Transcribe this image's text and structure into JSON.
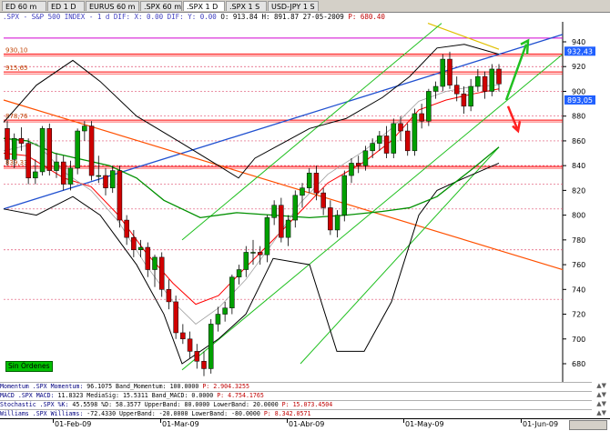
{
  "tabs": [
    {
      "label": "ED 60 m",
      "active": false
    },
    {
      "label": "ED 1 D",
      "active": false
    },
    {
      "label": "EURUS 60 m",
      "active": false
    },
    {
      "label": ".SPX 60 m",
      "active": false
    },
    {
      "label": ".SPX 1 D",
      "active": true
    },
    {
      "label": ".SPX 1 S",
      "active": false
    },
    {
      "label": "USD-JPY 1 S",
      "active": false
    }
  ],
  "header": {
    "symbol": ".SPX - S&P 500 INDEX - 1 d DIF: X: 0.00 DIF: Y: 0.00",
    "values": "O: 913.84 H: 891.87 27-05-2009",
    "p": "P: 680.40"
  },
  "levels": [
    {
      "label": "930,10",
      "value": 930.1,
      "color": "#ff0000"
    },
    {
      "label": "915,65",
      "value": 915.65,
      "color": "#ff0000"
    },
    {
      "label": "878,76",
      "value": 876.76,
      "color": "#ff0000"
    },
    {
      "label": "839,33",
      "value": 839.33,
      "color": "#ff0000"
    }
  ],
  "price_tags": [
    {
      "label": "932,43",
      "value": 932.43,
      "bg": "#2060ff"
    },
    {
      "label": "893,05",
      "value": 893.05,
      "bg": "#2060ff"
    }
  ],
  "status_badge": "Sin Órdenes",
  "indicators": [
    {
      "name": "Momentum .SPX Momentum:",
      "values": "96.1075 Band_Momentum: 100.0000",
      "p": "P: 2.904.3255"
    },
    {
      "name": "MACD .SPX MACD:",
      "values": "11.8323 MediaSig: 15.5311 Band_MACD: 0.0000",
      "p": "P: 4.754.1765"
    },
    {
      "name": "Stochastic .SPX %K:",
      "values": "45.5598 %D: 58.3577 UpperBand: 80.0000 LowerBand: 20.0000",
      "p": "P: 15.073.4504"
    },
    {
      "name": "Williams .SPX Williams:",
      "values": "-72.4330 UpperBand: -20.0000 LowerBand: -80.0000",
      "p": "P: 8.342.0571"
    }
  ],
  "x_labels": [
    "01-Feb-09",
    "01-Mar-09",
    "01-Abr-09",
    "01-May-09",
    "01-Jun-09"
  ],
  "chart_data": {
    "type": "candlestick",
    "y_ticks": [
      680,
      700,
      720,
      740,
      760,
      780,
      800,
      820,
      840,
      860,
      880,
      900,
      920,
      940
    ],
    "ylim": [
      670,
      950
    ],
    "candles": [
      [
        870,
        845,
        876,
        840
      ],
      [
        845,
        862,
        866,
        838
      ],
      [
        862,
        858,
        871,
        852
      ],
      [
        858,
        830,
        862,
        825
      ],
      [
        830,
        835,
        845,
        825
      ],
      [
        835,
        870,
        872,
        832
      ],
      [
        870,
        836,
        874,
        832
      ],
      [
        836,
        843,
        850,
        830
      ],
      [
        843,
        825,
        848,
        820
      ],
      [
        825,
        838,
        844,
        820
      ],
      [
        838,
        868,
        870,
        833
      ],
      [
        868,
        872,
        876,
        860
      ],
      [
        872,
        832,
        876,
        828
      ],
      [
        832,
        832,
        848,
        826
      ],
      [
        832,
        822,
        838,
        816
      ],
      [
        822,
        836,
        840,
        818
      ],
      [
        836,
        796,
        840,
        790
      ],
      [
        796,
        782,
        800,
        776
      ],
      [
        782,
        772,
        788,
        766
      ],
      [
        772,
        774,
        780,
        766
      ],
      [
        774,
        756,
        778,
        750
      ],
      [
        756,
        766,
        768,
        742
      ],
      [
        766,
        740,
        770,
        734
      ],
      [
        740,
        730,
        748,
        724
      ],
      [
        730,
        705,
        735,
        700
      ],
      [
        705,
        700,
        712,
        696
      ],
      [
        700,
        690,
        706,
        684
      ],
      [
        690,
        682,
        696,
        676
      ],
      [
        682,
        676,
        690,
        670
      ],
      [
        676,
        712,
        716,
        672
      ],
      [
        712,
        720,
        726,
        706
      ],
      [
        720,
        725,
        730,
        714
      ],
      [
        725,
        750,
        752,
        720
      ],
      [
        750,
        756,
        760,
        744
      ],
      [
        756,
        770,
        775,
        750
      ],
      [
        770,
        770,
        780,
        760
      ],
      [
        770,
        768,
        775,
        760
      ],
      [
        768,
        798,
        800,
        762
      ],
      [
        798,
        808,
        812,
        792
      ],
      [
        808,
        782,
        814,
        778
      ],
      [
        782,
        796,
        800,
        775
      ],
      [
        796,
        816,
        820,
        790
      ],
      [
        816,
        822,
        826,
        806
      ],
      [
        822,
        834,
        838,
        818
      ],
      [
        834,
        818,
        840,
        812
      ],
      [
        818,
        806,
        822,
        800
      ],
      [
        806,
        788,
        812,
        784
      ],
      [
        788,
        800,
        804,
        782
      ],
      [
        800,
        832,
        836,
        795
      ],
      [
        832,
        842,
        846,
        826
      ],
      [
        842,
        840,
        848,
        834
      ],
      [
        840,
        852,
        856,
        836
      ],
      [
        852,
        858,
        862,
        846
      ],
      [
        858,
        864,
        868,
        852
      ],
      [
        864,
        850,
        872,
        846
      ],
      [
        850,
        874,
        878,
        846
      ],
      [
        874,
        868,
        880,
        860
      ],
      [
        868,
        852,
        874,
        848
      ],
      [
        852,
        882,
        886,
        848
      ],
      [
        882,
        876,
        890,
        870
      ],
      [
        876,
        900,
        902,
        872
      ],
      [
        900,
        904,
        908,
        894
      ],
      [
        904,
        926,
        930,
        900
      ],
      [
        926,
        905,
        932,
        902
      ],
      [
        905,
        898,
        912,
        892
      ],
      [
        898,
        888,
        904,
        882
      ],
      [
        888,
        904,
        910,
        884
      ],
      [
        904,
        912,
        918,
        900
      ],
      [
        912,
        900,
        916,
        894
      ],
      [
        900,
        918,
        922,
        896
      ],
      [
        918,
        906,
        922,
        900
      ]
    ]
  }
}
